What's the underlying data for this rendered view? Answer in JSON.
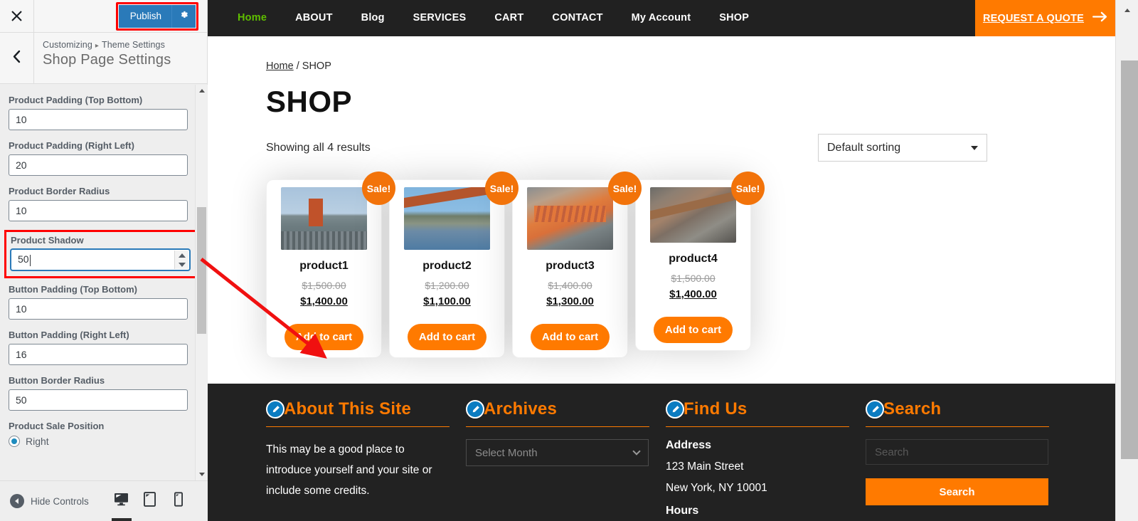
{
  "customizer": {
    "close_icon": "close-icon",
    "publish_label": "Publish",
    "gear_icon": "gear-icon",
    "back_icon": "chevron-left-icon",
    "breadcrumb_root": "Customizing",
    "breadcrumb_sep": "▸",
    "breadcrumb_parent": "Theme Settings",
    "panel_title": "Shop Page Settings",
    "highlight_color": "#ff0000",
    "publish_bg": "#2a7ab9",
    "fields": [
      {
        "label": "Product Padding (Top Bottom)",
        "value": "10"
      },
      {
        "label": "Product Padding (Right Left)",
        "value": "20"
      },
      {
        "label": "Product Border Radius",
        "value": "10"
      },
      {
        "label": "Product Shadow",
        "value": "50"
      },
      {
        "label": "Button Padding (Top Bottom)",
        "value": "10"
      },
      {
        "label": "Button Padding (Right Left)",
        "value": "16"
      },
      {
        "label": "Button Border Radius",
        "value": "50"
      }
    ],
    "sale_position": {
      "label": "Product Sale Position",
      "option_label": "Right",
      "checked": true
    },
    "footer": {
      "hide_controls_label": "Hide Controls",
      "devices": [
        {
          "name": "desktop-preview-button",
          "icon": "desktop-icon",
          "active": true
        },
        {
          "name": "tablet-preview-button",
          "icon": "tablet-icon",
          "active": false
        },
        {
          "name": "mobile-preview-button",
          "icon": "mobile-icon",
          "active": false
        }
      ]
    }
  },
  "site": {
    "nav": {
      "items": [
        {
          "label": "Home",
          "active": true
        },
        {
          "label": "ABOUT",
          "active": false
        },
        {
          "label": "Blog",
          "active": false
        },
        {
          "label": "SERVICES",
          "active": false
        },
        {
          "label": "CART",
          "active": false
        },
        {
          "label": "CONTACT",
          "active": false
        },
        {
          "label": "My Account",
          "active": false
        },
        {
          "label": "SHOP",
          "active": false
        }
      ],
      "active_color": "#5fbf00",
      "bar_bg": "#212121",
      "quote_label": "REQUEST A QUOTE",
      "quote_arrow": "→",
      "quote_bg": "#ff7a00"
    },
    "breadcrumb": {
      "home": "Home",
      "separator": "/",
      "current": "SHOP"
    },
    "page_title": "SHOP",
    "results_count": "Showing all 4 results",
    "sorting": {
      "selected": "Default sorting"
    },
    "sale_badge_label": "Sale!",
    "add_to_cart_label": "Add to cart",
    "products": [
      {
        "name": "product1",
        "old_price": "$1,500.00",
        "new_price": "$1,400.00",
        "image": "bridge-tower-photo"
      },
      {
        "name": "product2",
        "old_price": "$1,200.00",
        "new_price": "$1,100.00",
        "image": "golden-gate-bridge-photo"
      },
      {
        "name": "product3",
        "old_price": "$1,400.00",
        "new_price": "$1,300.00",
        "image": "rusty-metal-photo"
      },
      {
        "name": "product4",
        "old_price": "$1,500.00",
        "new_price": "$1,400.00",
        "image": "railway-track-photo"
      }
    ],
    "footer": {
      "edit_icon": "pencil-edit-icon",
      "accent": "#ff7a00",
      "about": {
        "heading": "About This Site",
        "text": "This may be a good place to introduce yourself and your site or include some credits."
      },
      "archives": {
        "heading": "Archives",
        "select_placeholder": "Select Month"
      },
      "find_us": {
        "heading": "Find Us",
        "address_title": "Address",
        "address_line1": "123 Main Street",
        "address_line2": "New York, NY 10001",
        "hours_title": "Hours"
      },
      "search": {
        "heading": "Search",
        "placeholder": "Search",
        "button_label": "Search"
      }
    }
  }
}
